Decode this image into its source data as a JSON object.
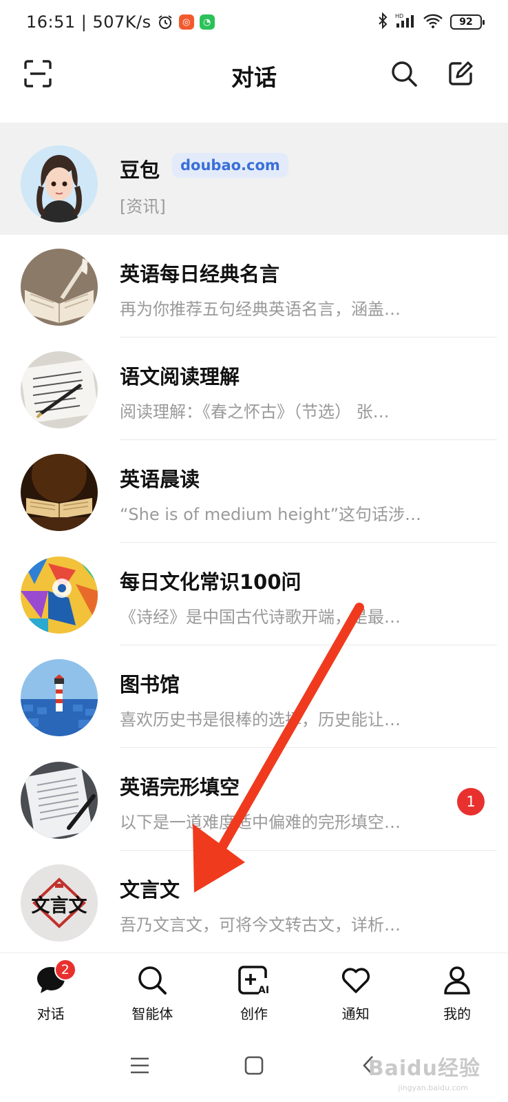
{
  "status_bar": {
    "time": "16:51 | 507K/s",
    "battery": "92"
  },
  "header": {
    "title": "对话"
  },
  "chats": [
    {
      "name": "豆包",
      "badge": "doubao.com",
      "preview": "[资讯]"
    },
    {
      "name": "英语每日经典名言",
      "preview": "再为你推荐五句经典英语名言，涵盖…"
    },
    {
      "name": "语文阅读理解",
      "preview": "阅读理解：《春之怀古》（节选） 张…"
    },
    {
      "name": "英语晨读",
      "preview": "“She is of medium height”这句话涉…"
    },
    {
      "name": "每日文化常识100问",
      "preview": "《诗经》是中国古代诗歌开端，是最…"
    },
    {
      "name": "图书馆",
      "preview": "喜欢历史书是很棒的选择，历史能让…"
    },
    {
      "name": "英语完形填空",
      "preview": "以下是一道难度适中偏难的完形填空…",
      "unread": "1"
    },
    {
      "name": "文言文",
      "preview": "吾乃文言文，可将今文转古文，详析…",
      "avatar_text": "文言文"
    }
  ],
  "tabs": [
    {
      "label": "对话",
      "badge": "2"
    },
    {
      "label": "智能体"
    },
    {
      "label": "创作"
    },
    {
      "label": "通知"
    },
    {
      "label": "我的"
    }
  ],
  "watermark": {
    "text": "Baidu经验",
    "sub": "jingyan.baidu.com"
  },
  "colors": {
    "badge_red": "#e8312f",
    "link_blue": "#3a6fd8",
    "arrow_red": "#f03a1e"
  }
}
